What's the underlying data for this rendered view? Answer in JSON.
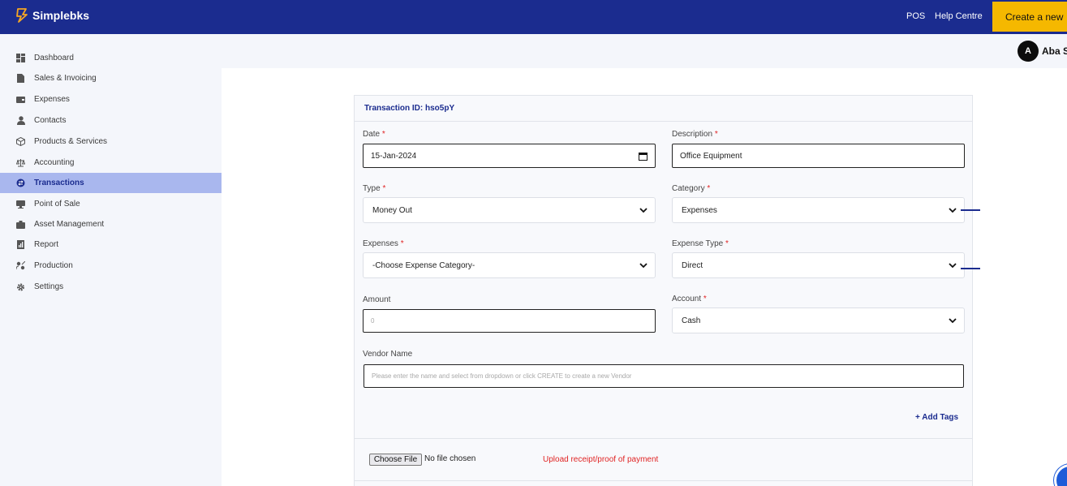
{
  "brand": {
    "name": "Simplebks",
    "icon": "simplebks-logo-icon",
    "color": "#f5a623"
  },
  "topnav": {
    "pos": "POS",
    "help": "Help Centre",
    "create": "Create a new"
  },
  "user": {
    "initial": "A",
    "name": "Aba S"
  },
  "colors": {
    "primary": "#1b2c8f",
    "accent": "#f5b800",
    "active_bg": "#a9b7ee",
    "required": "#e02424"
  },
  "sidebar": {
    "items": [
      {
        "label": "Dashboard",
        "icon": "dashboard-icon",
        "active": false
      },
      {
        "label": "Sales & Invoicing",
        "icon": "document-icon",
        "active": false
      },
      {
        "label": "Expenses",
        "icon": "wallet-icon",
        "active": false
      },
      {
        "label": "Contacts",
        "icon": "person-icon",
        "active": false
      },
      {
        "label": "Products & Services",
        "icon": "box-icon",
        "active": false
      },
      {
        "label": "Accounting",
        "icon": "scale-icon",
        "active": false
      },
      {
        "label": "Transactions",
        "icon": "transfer-icon",
        "active": true
      },
      {
        "label": "Point of Sale",
        "icon": "monitor-icon",
        "active": false
      },
      {
        "label": "Asset Management",
        "icon": "asset-icon",
        "active": false
      },
      {
        "label": "Report",
        "icon": "report-icon",
        "active": false
      },
      {
        "label": "Production",
        "icon": "production-icon",
        "active": false
      },
      {
        "label": "Settings",
        "icon": "gear-icon",
        "active": false
      }
    ]
  },
  "form": {
    "transaction_id": "Transaction ID: hso5pY",
    "date": {
      "label": "Date",
      "value": "15-Jan-2024"
    },
    "description": {
      "label": "Description",
      "value": "Office Equipment"
    },
    "type": {
      "label": "Type",
      "value": "Money Out"
    },
    "category": {
      "label": "Category",
      "value": "Expenses"
    },
    "expenses": {
      "label": "Expenses",
      "value": "-Choose Expense Category-"
    },
    "expense_type": {
      "label": "Expense Type",
      "value": "Direct"
    },
    "amount": {
      "label": "Amount",
      "placeholder": "0"
    },
    "account": {
      "label": "Account",
      "value": "Cash"
    },
    "vendor": {
      "label": "Vendor Name",
      "placeholder": "Please enter the name and select from dropdown or click CREATE to create a new Vendor"
    },
    "required_mark": "*",
    "add_tags": "+ Add Tags",
    "file": {
      "button": "Choose File",
      "status": "No file chosen",
      "note": "Upload receipt/proof of payment"
    }
  }
}
